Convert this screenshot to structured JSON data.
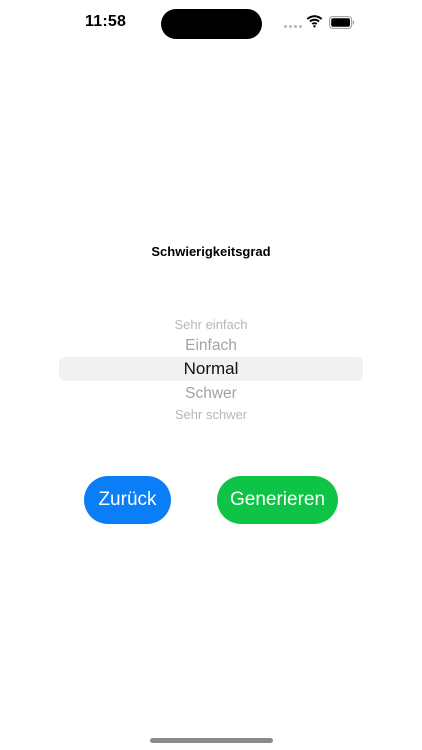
{
  "status_bar": {
    "time": "11:58",
    "icons": [
      "signal-dots-icon",
      "wifi-icon",
      "battery-icon"
    ]
  },
  "picker": {
    "title": "Schwierigkeitsgrad",
    "options": [
      "Sehr einfach",
      "Einfach",
      "Normal",
      "Schwer",
      "Sehr schwer"
    ],
    "selected": "Normal"
  },
  "buttons": {
    "back_label": "Zurück",
    "generate_label": "Generieren"
  },
  "colors": {
    "back_button": "#0a7ef7",
    "generate_button": "#0ec446",
    "picker_highlight": "#f1f1f3"
  }
}
